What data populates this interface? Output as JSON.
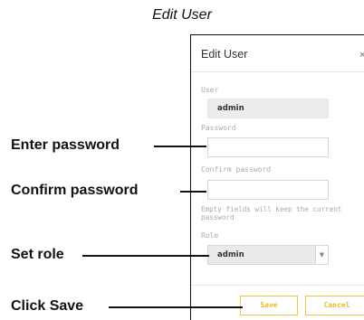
{
  "figure_title": "Edit User",
  "dialog": {
    "title": "Edit User",
    "close_glyph": "×",
    "user": {
      "label": "User",
      "value": "admin"
    },
    "password": {
      "label": "Password",
      "value": ""
    },
    "confirm_password": {
      "label": "Confirm password",
      "value": ""
    },
    "hint": "Empty fields will keep the current password",
    "role": {
      "label": "Role",
      "selected": "admin",
      "dropdown_icon": "chevron-down-icon"
    },
    "buttons": {
      "save": "Save",
      "cancel": "Cancel"
    },
    "accent_color": "#f5c542"
  },
  "callouts": {
    "enter_password": "Enter password",
    "confirm_password": "Confirm password",
    "set_role": "Set role",
    "click_save": "Click Save"
  }
}
